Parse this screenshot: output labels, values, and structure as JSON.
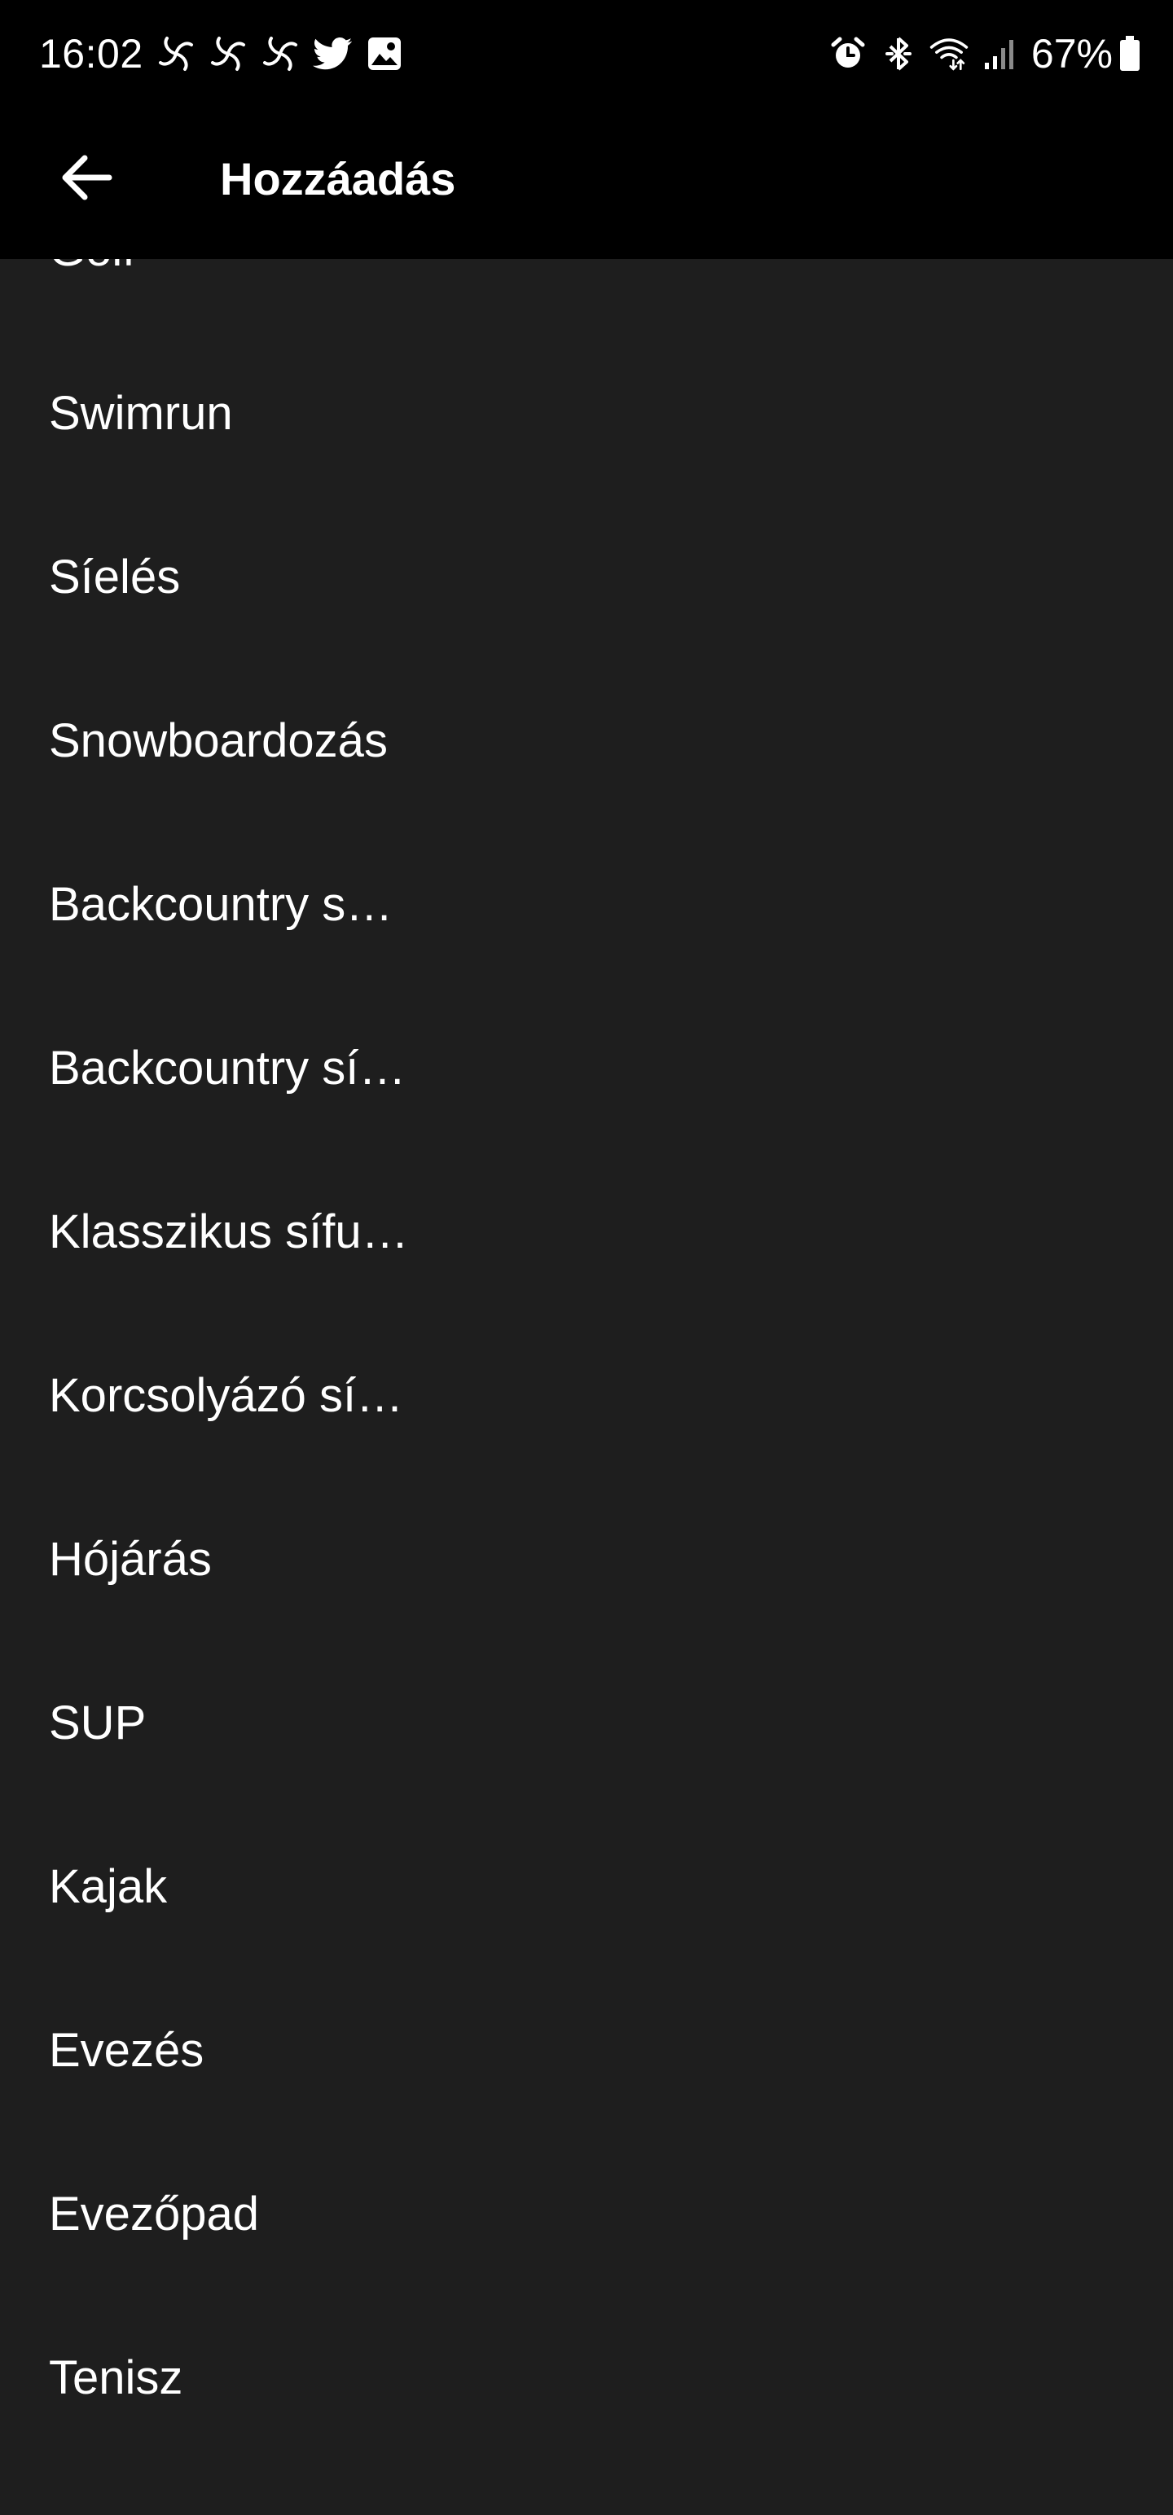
{
  "status_bar": {
    "time": "16:02",
    "battery": "67%",
    "notification_icons": [
      "pinwheel-icon",
      "pinwheel-icon",
      "pinwheel-icon",
      "twitter-icon",
      "gallery-icon"
    ],
    "system_icons": [
      "alarm-icon",
      "bluetooth-icon",
      "wifi-icon",
      "signal-icon"
    ]
  },
  "app_bar": {
    "title": "Hozzáadás",
    "back_icon": "arrow-left-icon"
  },
  "list": {
    "items": [
      {
        "label": "Golf"
      },
      {
        "label": "Swimrun"
      },
      {
        "label": "Síelés"
      },
      {
        "label": "Snowboardozás"
      },
      {
        "label": "Backcountry s…"
      },
      {
        "label": "Backcountry sí…"
      },
      {
        "label": "Klasszikus sífu…"
      },
      {
        "label": "Korcsolyázó sí…"
      },
      {
        "label": "Hójárás"
      },
      {
        "label": "SUP"
      },
      {
        "label": "Kajak"
      },
      {
        "label": "Evezés"
      },
      {
        "label": "Evezőpad"
      },
      {
        "label": "Tenisz"
      }
    ]
  },
  "colors": {
    "status_bar_bg": "#000000",
    "app_bar_bg": "#000000",
    "list_bg": "#1e1e1e",
    "text": "#ffffff"
  }
}
